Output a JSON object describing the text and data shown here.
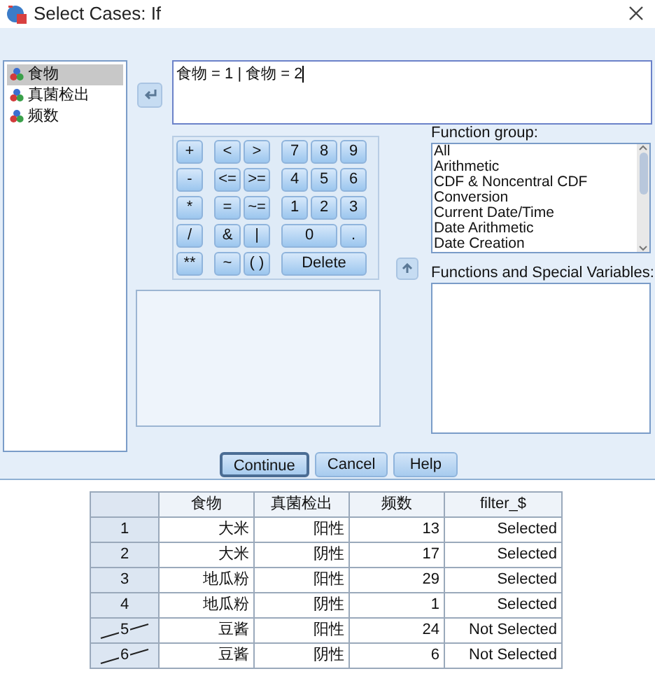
{
  "window": {
    "title": "Select Cases: If"
  },
  "variables": [
    {
      "name": "食物",
      "selected": true
    },
    {
      "name": "真菌检出",
      "selected": false
    },
    {
      "name": "频数",
      "selected": false
    }
  ],
  "expression": {
    "value": "食物 = 1 | 食物 = 2"
  },
  "keypad": [
    [
      "+",
      "<",
      ">",
      "7",
      "8",
      "9"
    ],
    [
      "-",
      "<=",
      ">=",
      "4",
      "5",
      "6"
    ],
    [
      "*",
      "=",
      "~=",
      "1",
      "2",
      "3"
    ],
    [
      "/",
      "&",
      "|",
      {
        "label": "0",
        "kind": "double"
      },
      "."
    ],
    [
      "**",
      "~",
      "( )",
      {
        "label": "Delete",
        "kind": "triple"
      }
    ]
  ],
  "function_group": {
    "label": "Function group:",
    "items": [
      "All",
      "Arithmetic",
      "CDF & Noncentral CDF",
      "Conversion",
      "Current Date/Time",
      "Date Arithmetic",
      "Date Creation"
    ]
  },
  "functions": {
    "label": "Functions and Special Variables:"
  },
  "buttons": [
    {
      "label": "Continue",
      "focused": true
    },
    {
      "label": "Cancel",
      "focused": false
    },
    {
      "label": "Help",
      "focused": false
    }
  ],
  "table": {
    "columns": [
      "食物",
      "真菌检出",
      "频数",
      "filter_$"
    ],
    "rows": [
      {
        "number": "1",
        "filtered_out": false,
        "cells": [
          "大米",
          "阳性",
          "13",
          "Selected"
        ]
      },
      {
        "number": "2",
        "filtered_out": false,
        "cells": [
          "大米",
          "阴性",
          "17",
          "Selected"
        ]
      },
      {
        "number": "3",
        "filtered_out": false,
        "cells": [
          "地瓜粉",
          "阳性",
          "29",
          "Selected"
        ]
      },
      {
        "number": "4",
        "filtered_out": false,
        "cells": [
          "地瓜粉",
          "阴性",
          "1",
          "Selected"
        ]
      },
      {
        "number": "5",
        "filtered_out": true,
        "cells": [
          "豆酱",
          "阳性",
          "24",
          "Not Selected"
        ]
      },
      {
        "number": "6",
        "filtered_out": true,
        "cells": [
          "豆酱",
          "阴性",
          "6",
          "Not Selected"
        ]
      }
    ]
  }
}
